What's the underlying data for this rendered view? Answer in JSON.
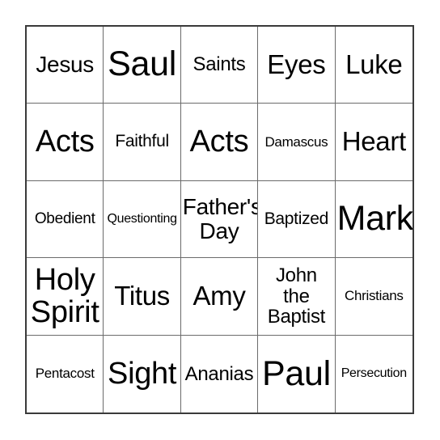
{
  "card": {
    "type": "bingo-card",
    "columns": 5,
    "rows": 5,
    "background_color": "#ffffff",
    "text_color": "#000000",
    "outer_border_color": "#3a3a3a",
    "grid_line_color": "#6b6b6b",
    "cells": [
      {
        "text": "Jesus",
        "size": "fs-l"
      },
      {
        "text": "Saul",
        "size": "fs-huge"
      },
      {
        "text": "Saints",
        "size": "fs-ml"
      },
      {
        "text": "Eyes",
        "size": "fs-xl"
      },
      {
        "text": "Luke",
        "size": "fs-xl"
      },
      {
        "text": "Acts",
        "size": "fs-xxl"
      },
      {
        "text": "Faithful",
        "size": "fs-m"
      },
      {
        "text": "Acts",
        "size": "fs-xxl"
      },
      {
        "text": "Damascus",
        "size": "fs-s"
      },
      {
        "text": "Heart",
        "size": "fs-xl"
      },
      {
        "text": "Obedient",
        "size": "fs-sm"
      },
      {
        "text": "Questionting",
        "size": "fs-xs"
      },
      {
        "text": "Father's\nDay",
        "size": "fs-l"
      },
      {
        "text": "Baptized",
        "size": "fs-m"
      },
      {
        "text": "Mark",
        "size": "fs-huge"
      },
      {
        "text": "Holy\nSpirit",
        "size": "fs-xxl"
      },
      {
        "text": "Titus",
        "size": "fs-xl"
      },
      {
        "text": "Amy",
        "size": "fs-xl"
      },
      {
        "text": "John\nthe\nBaptist",
        "size": "fs-ml"
      },
      {
        "text": "Christians",
        "size": "fs-s"
      },
      {
        "text": "Pentacost",
        "size": "fs-s"
      },
      {
        "text": "Sight",
        "size": "fs-xxl"
      },
      {
        "text": "Ananias",
        "size": "fs-ml"
      },
      {
        "text": "Paul",
        "size": "fs-huge"
      },
      {
        "text": "Persecution",
        "size": "fs-xs"
      }
    ]
  }
}
